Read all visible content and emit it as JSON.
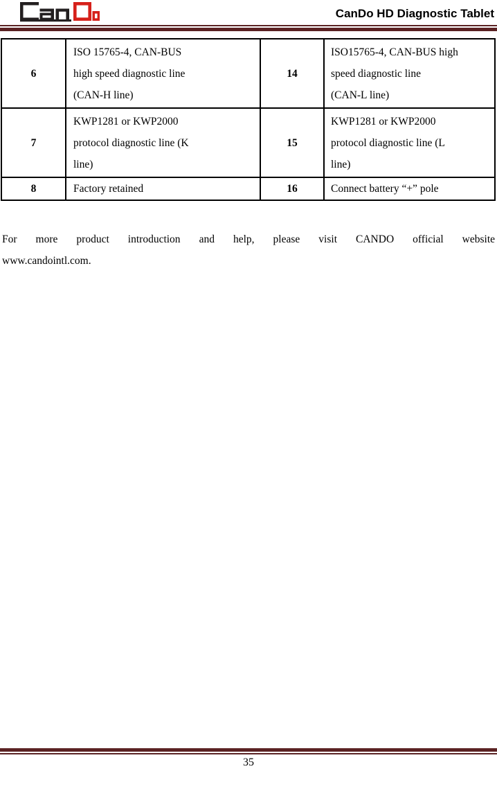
{
  "header": {
    "logo_alt": "CanDo logo",
    "logo_text_dark": "Can",
    "logo_text_red": "Do",
    "logo_color_dark": "#231F20",
    "logo_color_red": "#D6211A",
    "title": "CanDo HD Diagnostic Tablet",
    "rule_color": "#5B2223"
  },
  "table": {
    "rows": [
      {
        "pin_left": "6",
        "desc_left_lines": [
          "ISO 15765-4, CAN-BUS",
          "high speed diagnostic line",
          "(CAN-H line)"
        ],
        "pin_right": "14",
        "desc_right_lines": [
          "ISO15765-4, CAN-BUS high",
          "speed diagnostic line",
          "(CAN-L line)"
        ]
      },
      {
        "pin_left": "7",
        "desc_left_lines": [
          "KWP1281 or KWP2000",
          "protocol diagnostic line (K",
          "line)"
        ],
        "pin_right": "15",
        "desc_right_lines": [
          "KWP1281 or KWP2000",
          "protocol diagnostic line (L",
          "line)"
        ]
      },
      {
        "pin_left": "8",
        "desc_left_lines": [
          "Factory retained"
        ],
        "pin_right": "16",
        "desc_right_lines": [
          "Connect battery “+” pole"
        ]
      }
    ]
  },
  "paragraph": {
    "line1": "For more product introduction and help, please visit CANDO official website",
    "line2": "www.candointl.com."
  },
  "footer": {
    "page_number": "35",
    "rule_color": "#5B2223"
  }
}
